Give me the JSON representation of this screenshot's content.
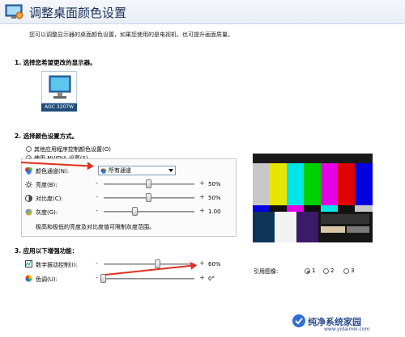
{
  "header": {
    "title": "调整桌面颜色设置"
  },
  "description": "您可以调整显示器的桌面颜色设置，如果您使用的是电视机，也可提升画面质量。",
  "section1": {
    "heading": "1. 选择您希望更改的显示器。",
    "monitor_label": "AOC 3207W"
  },
  "section2": {
    "heading": "2. 选择颜色设置方式。",
    "option_other": "其他应用程序控制颜色设置(O)",
    "option_nvidia": "使用 NVIDIA 设置(S)",
    "channel_label": "颜色通道(N):",
    "channel_value": "所有通道",
    "brightness_label": "亮度(B):",
    "brightness_value": "50%",
    "brightness_level": 0.5,
    "contrast_label": "对比度(C):",
    "contrast_value": "50%",
    "contrast_level": 0.5,
    "gamma_label": "灰度(G):",
    "gamma_value": "1.00",
    "gamma_level": 0.35,
    "note": "极高和极低的亮度及对比度值可限制灰度范围。",
    "minus": "-",
    "plus": "+"
  },
  "section3": {
    "heading": "3. 应用以下增强功能：",
    "vibrance_label": "数字振动控制(I):",
    "vibrance_value": "60%",
    "vibrance_level": 0.6,
    "hue_label": "色调(U):",
    "hue_value": "0°",
    "hue_level": 0.0,
    "ref_label": "引用图像:",
    "ref_options": [
      "1",
      "2",
      "3"
    ],
    "ref_selected": "1"
  },
  "watermark": {
    "main": "纯净系统家园",
    "sub": "www.yidaimei.com"
  },
  "colors": {
    "accent": "#1e5da8",
    "arrow": "#e03020"
  }
}
